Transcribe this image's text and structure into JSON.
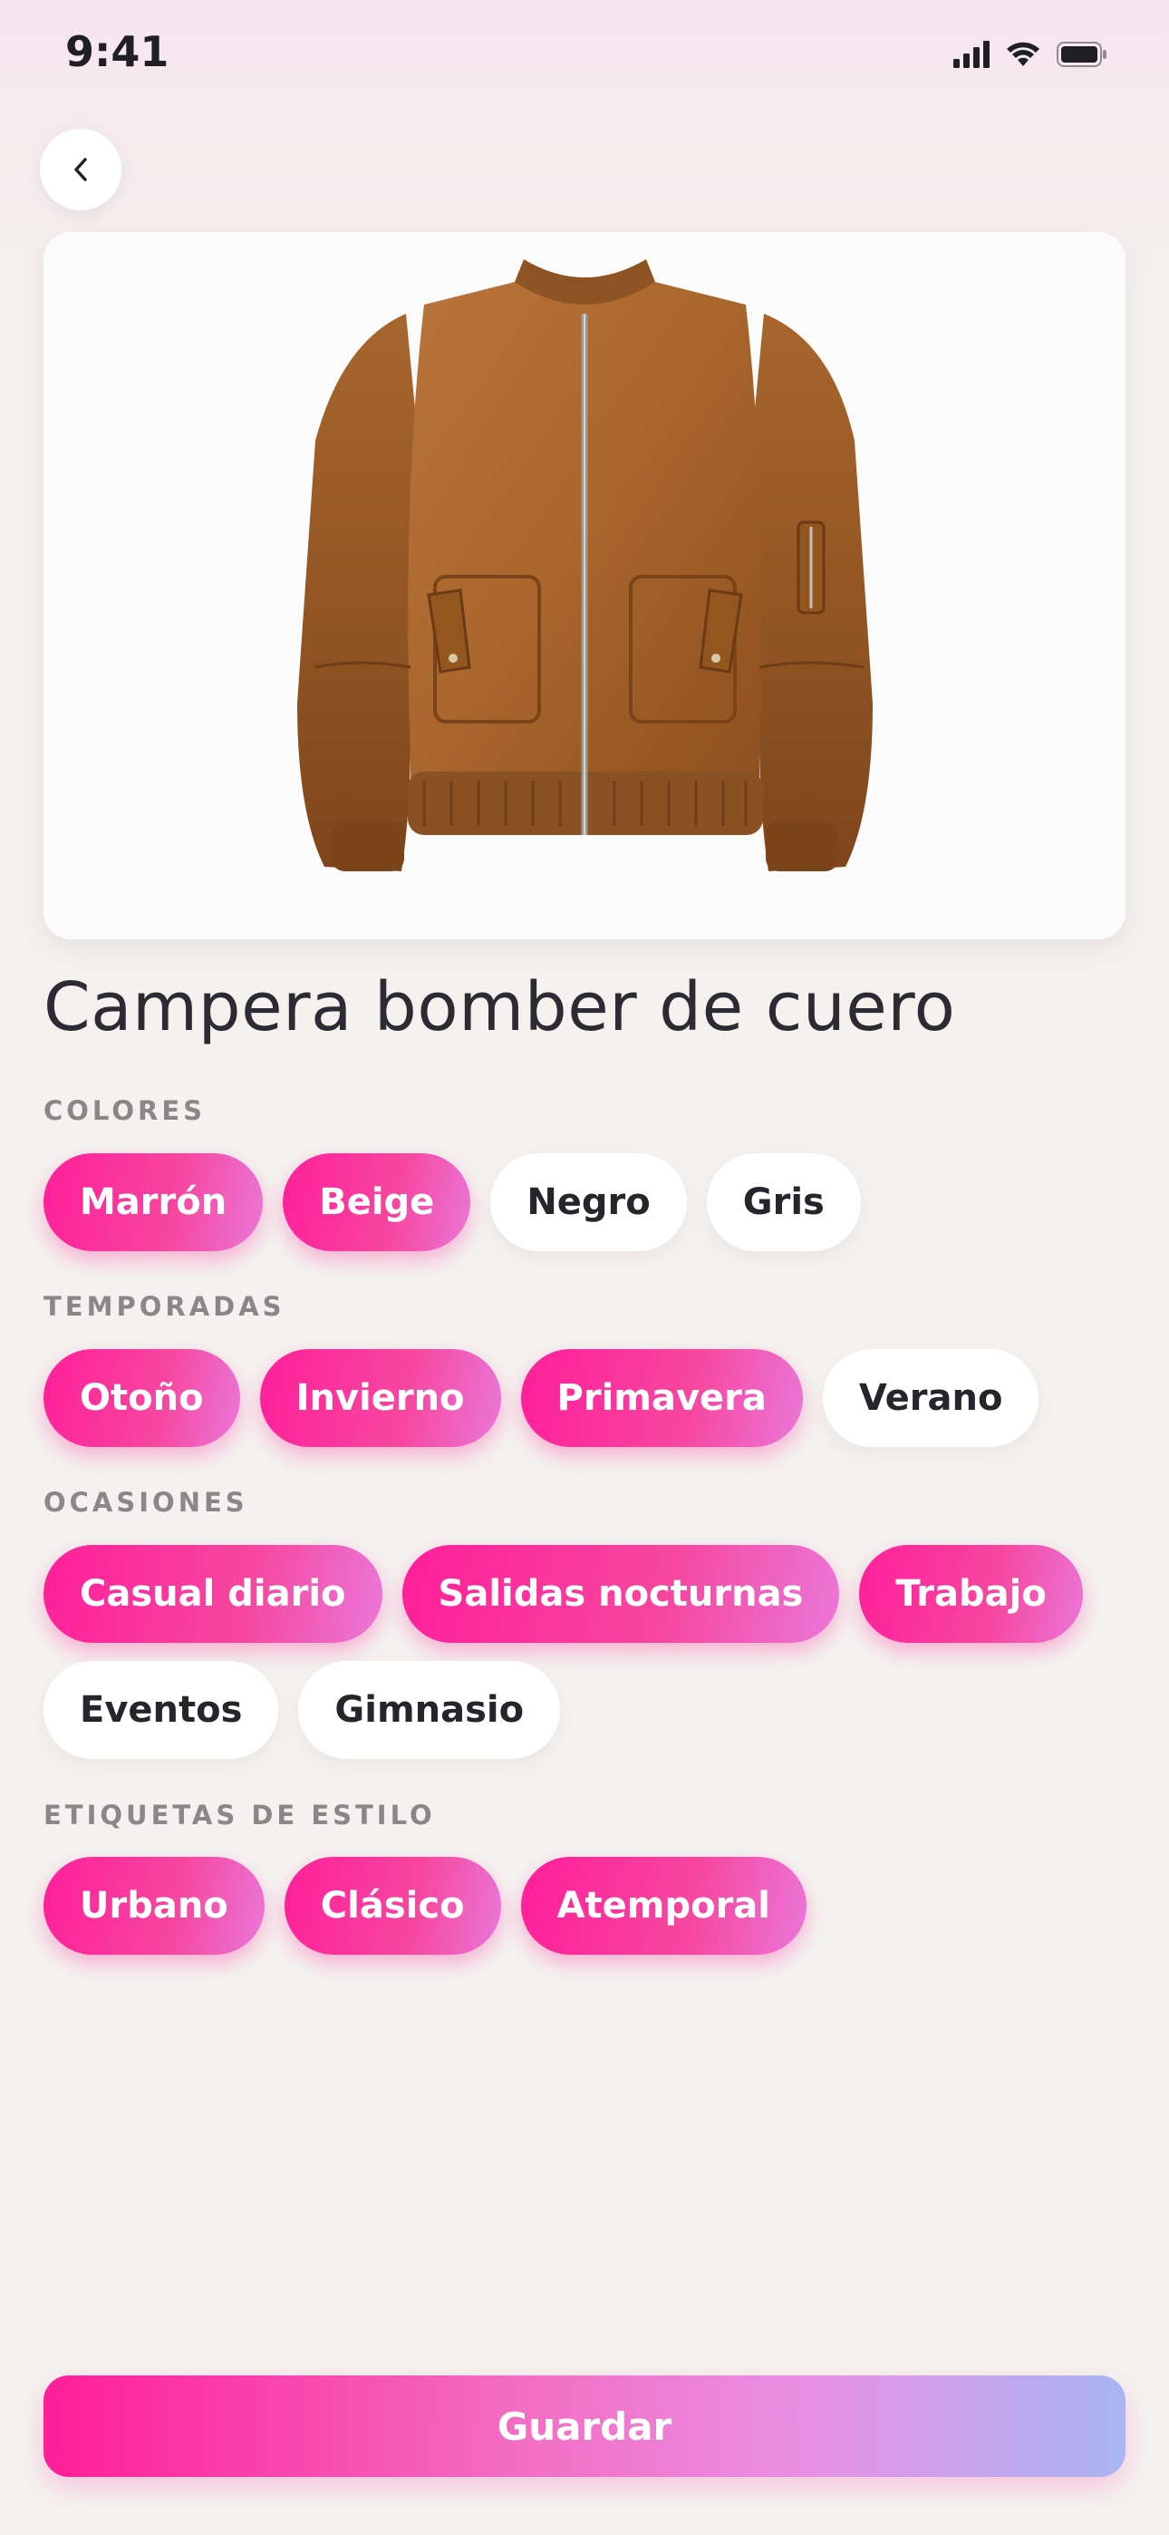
{
  "status_bar": {
    "time": "9:41"
  },
  "item": {
    "title": "Campera bomber de cuero"
  },
  "sections": {
    "colors": {
      "label": "COLORES",
      "chips": [
        {
          "label": "Marrón",
          "selected": true
        },
        {
          "label": "Beige",
          "selected": true
        },
        {
          "label": "Negro",
          "selected": false
        },
        {
          "label": "Gris",
          "selected": false
        }
      ]
    },
    "seasons": {
      "label": "TEMPORADAS",
      "chips": [
        {
          "label": "Otoño",
          "selected": true
        },
        {
          "label": "Invierno",
          "selected": true
        },
        {
          "label": "Primavera",
          "selected": true
        },
        {
          "label": "Verano",
          "selected": false
        }
      ]
    },
    "occasions": {
      "label": "OCASIONES",
      "chips": [
        {
          "label": "Casual diario",
          "selected": true
        },
        {
          "label": "Salidas nocturnas",
          "selected": true
        },
        {
          "label": "Trabajo",
          "selected": true
        },
        {
          "label": "Eventos",
          "selected": false
        },
        {
          "label": "Gimnasio",
          "selected": false
        }
      ]
    },
    "style_tags": {
      "label": "ETIQUETAS DE ESTILO",
      "chips": [
        {
          "label": "Urbano",
          "selected": true
        },
        {
          "label": "Clásico",
          "selected": true
        },
        {
          "label": "Atemporal",
          "selected": true
        }
      ]
    }
  },
  "actions": {
    "save_label": "Guardar"
  },
  "icons": {
    "back": "chevron-left-icon",
    "signal": "cellular-signal-icon",
    "wifi": "wifi-icon",
    "battery": "battery-icon"
  },
  "colors": {
    "accent": "#ff1f9a",
    "accent_end": "#ea77d8",
    "save_gradient_end": "#a9b5f2",
    "chip_off_bg": "#ffffff",
    "page_bg": "#f4f2f0"
  }
}
